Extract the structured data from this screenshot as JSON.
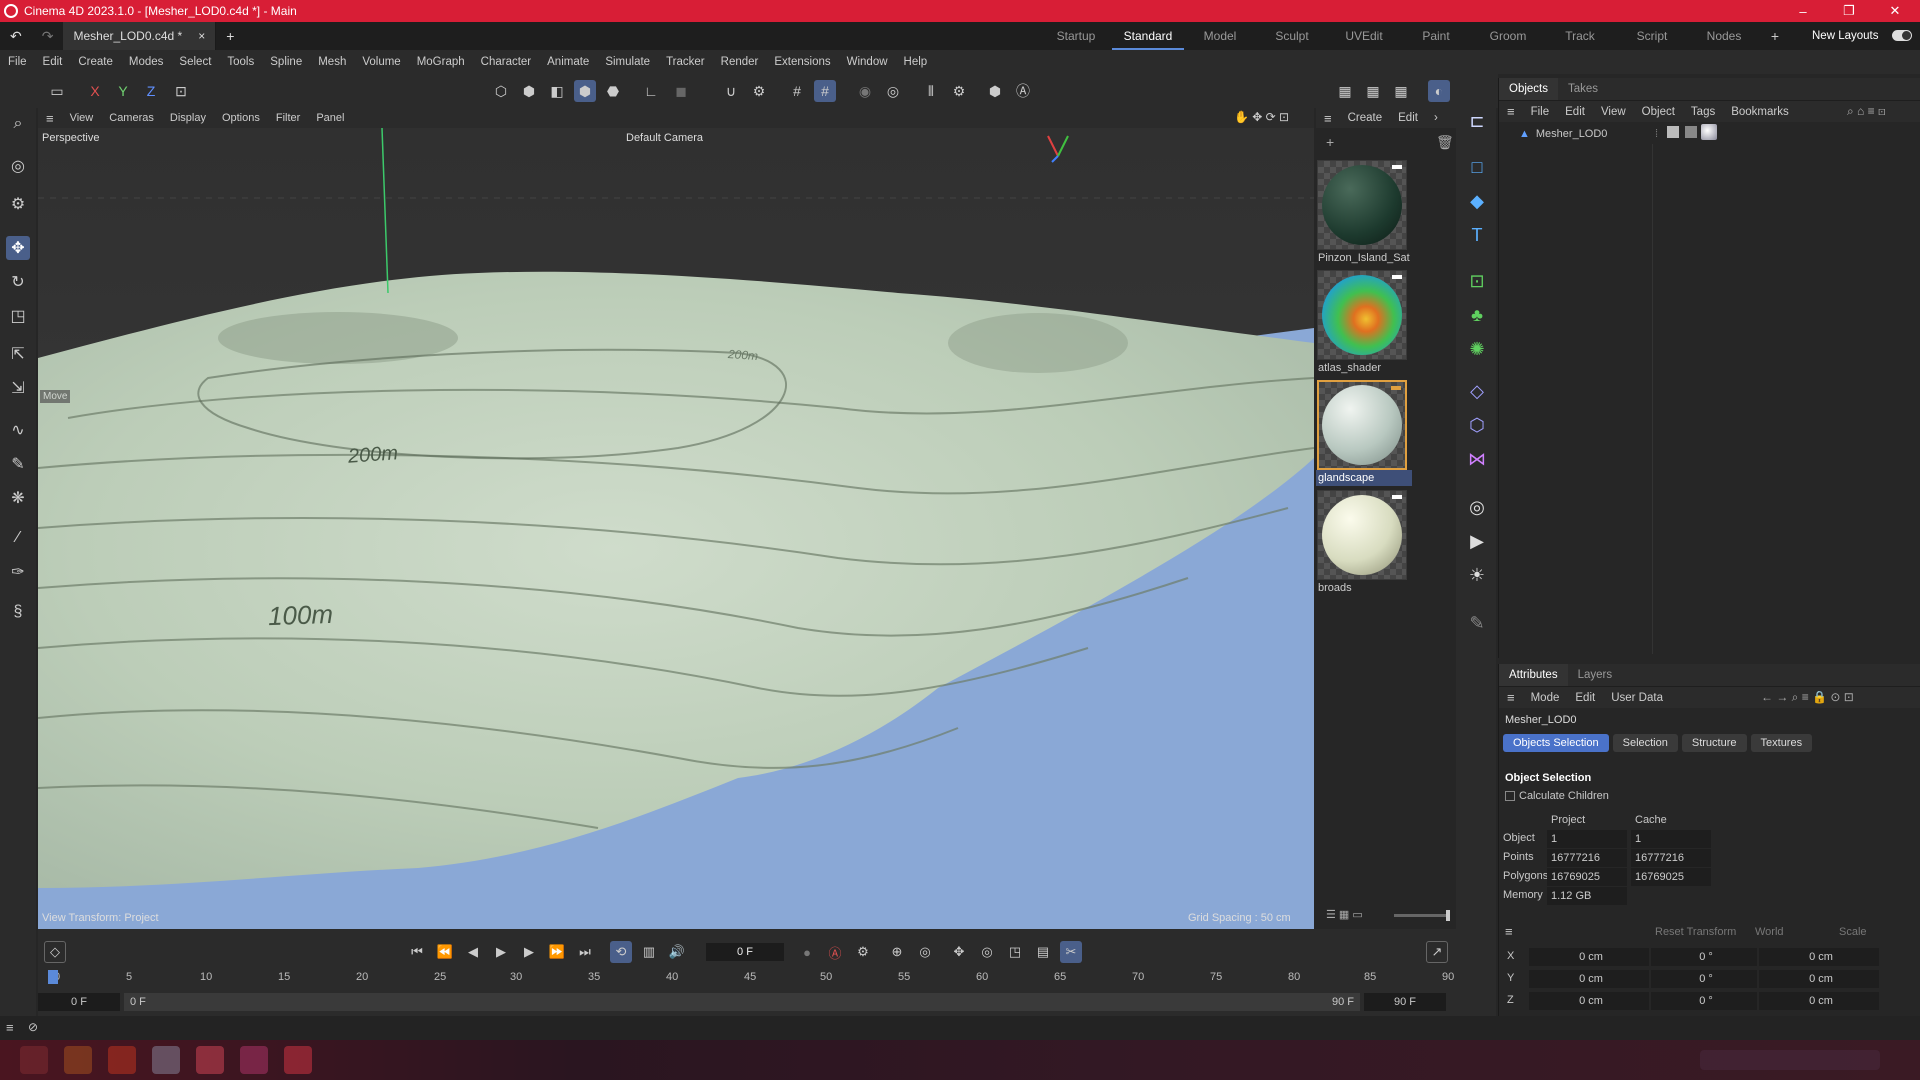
{
  "window": {
    "title": "Cinema 4D 2023.1.0 - [Mesher_LOD0.c4d *] - Main",
    "controls": [
      "–",
      "❐",
      "✕"
    ]
  },
  "doc_tab": {
    "label": "Mesher_LOD0.c4d *",
    "close": "×",
    "add": "+"
  },
  "layouts": [
    "Startup",
    "Standard",
    "Model",
    "Sculpt",
    "UVEdit",
    "Paint",
    "Groom",
    "Track",
    "Script",
    "Nodes"
  ],
  "layouts_add": "+",
  "new_layouts": "New Layouts",
  "menu": [
    "File",
    "Edit",
    "Create",
    "Modes",
    "Select",
    "Tools",
    "Spline",
    "Mesh",
    "Volume",
    "MoGraph",
    "Character",
    "Animate",
    "Simulate",
    "Tracker",
    "Render",
    "Extensions",
    "Window",
    "Help"
  ],
  "axis_buttons": [
    "X",
    "Y",
    "Z"
  ],
  "viewport_menu": [
    "View",
    "Cameras",
    "Display",
    "Options",
    "Filter",
    "Panel"
  ],
  "viewport": {
    "projection": "Perspective",
    "camera": "Default Camera",
    "view_transform": "View Transform: Project",
    "grid_spacing": "Grid Spacing : 50 cm",
    "tool_tip": "Move",
    "contours": [
      "200m",
      "100m",
      "200m"
    ]
  },
  "material_menu": [
    "Create",
    "Edit"
  ],
  "materials": [
    {
      "name": "Pinzon_Island_Sat"
    },
    {
      "name": "atlas_shader"
    },
    {
      "name": "glandscape"
    },
    {
      "name": "broads"
    }
  ],
  "objects_panel": {
    "tabs": [
      "Objects",
      "Takes"
    ],
    "menu": [
      "File",
      "Edit",
      "View",
      "Object",
      "Tags",
      "Bookmarks"
    ],
    "object_name": "Mesher_LOD0"
  },
  "attributes": {
    "tabs": [
      "Attributes",
      "Layers"
    ],
    "menu": [
      "Mode",
      "Edit",
      "User Data"
    ],
    "object_name": "Mesher_LOD0",
    "subtabs": [
      "Objects Selection",
      "Selection",
      "Structure",
      "Textures"
    ],
    "section": "Object Selection",
    "calculate_children": "Calculate Children",
    "col_project": "Project",
    "col_cache": "Cache",
    "rows": [
      {
        "label": "Object",
        "project": "1",
        "cache": "1"
      },
      {
        "label": "Points",
        "project": "16777216",
        "cache": "16777216"
      },
      {
        "label": "Polygons",
        "project": "16769025",
        "cache": "16769025"
      },
      {
        "label": "Memory",
        "project": "1.12 GB",
        "cache": ""
      }
    ]
  },
  "coordinates": {
    "reset": "Reset Transform",
    "space": "World",
    "mode": "Scale",
    "rows": [
      {
        "axis": "X",
        "pos": "0 cm",
        "rot": "0 °",
        "scale": "0 cm"
      },
      {
        "axis": "Y",
        "pos": "0 cm",
        "rot": "0 °",
        "scale": "0 cm"
      },
      {
        "axis": "Z",
        "pos": "0 cm",
        "rot": "0 °",
        "scale": "0 cm"
      }
    ]
  },
  "timeline": {
    "current_frame": "0 F",
    "ticks": [
      "0",
      "5",
      "10",
      "15",
      "20",
      "25",
      "30",
      "35",
      "40",
      "45",
      "50",
      "55",
      "60",
      "65",
      "70",
      "75",
      "80",
      "85",
      "90"
    ],
    "start": "0 F",
    "min": "0 F",
    "max": "90 F",
    "end": "90 F"
  }
}
